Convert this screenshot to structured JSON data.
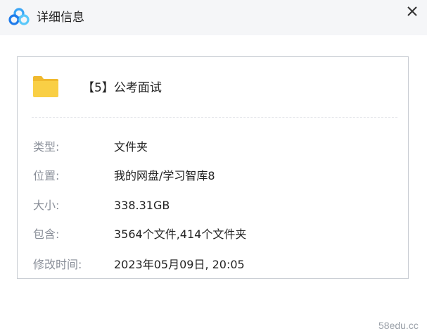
{
  "titlebar": {
    "title": "详细信息",
    "logo_icon": "baidu-netdisk-logo-icon",
    "close_icon": "close-icon"
  },
  "folder": {
    "icon": "folder-icon",
    "name": "【5】公考面试"
  },
  "details": [
    {
      "label": "类型:",
      "value": "文件夹"
    },
    {
      "label": "位置:",
      "value": "我的网盘/学习智库8"
    },
    {
      "label": "大小:",
      "value": "338.31GB"
    },
    {
      "label": "包含:",
      "value": "3564个文件,414个文件夹"
    },
    {
      "label": "修改时间:",
      "value": "2023年05月09日, 20:05"
    }
  ],
  "watermark": "58edu.cc",
  "colors": {
    "titlebar_bg": "#f5f6f8",
    "folder_yellow": "#f9cf45",
    "label_gray": "#8a8f99",
    "text_dark": "#222222",
    "card_border": "#c9cdd3"
  }
}
